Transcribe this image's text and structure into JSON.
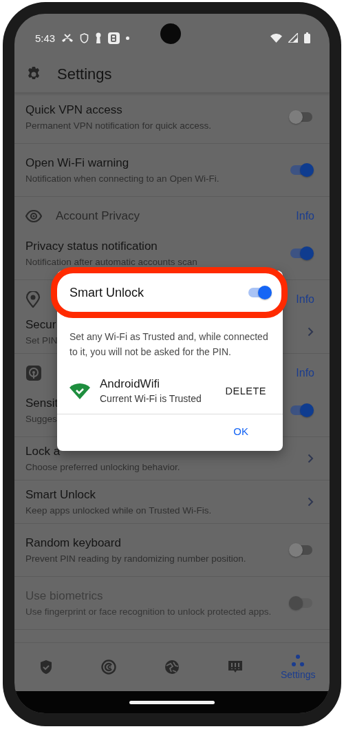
{
  "status_bar": {
    "time": "5:43"
  },
  "app_bar": {
    "title": "Settings"
  },
  "rows": [
    {
      "kind": "toggle",
      "title": "Quick VPN access",
      "subtitle": "Permanent VPN notification for quick access.",
      "on": false,
      "disabled": false
    },
    {
      "kind": "toggle",
      "title": "Open Wi-Fi warning",
      "subtitle": "Notification when connecting to an Open Wi-Fi.",
      "on": true,
      "disabled": false
    },
    {
      "kind": "section",
      "title": "Account Privacy",
      "info": "Info"
    },
    {
      "kind": "toggle",
      "title": "Privacy status notification",
      "subtitle": "Notification after automatic accounts scan",
      "on": true,
      "disabled": false
    },
    {
      "kind": "section",
      "info": "Info"
    },
    {
      "kind": "link",
      "title": "Secur",
      "subtitle": "Set PIN"
    },
    {
      "kind": "section",
      "info": "Info"
    },
    {
      "kind": "toggle",
      "title": "Sensit",
      "subtitle": "Sugges",
      "on": true,
      "disabled": false
    },
    {
      "kind": "link",
      "title": "Lock a",
      "subtitle": "Choose preferred unlocking behavior."
    },
    {
      "kind": "link",
      "title": "Smart Unlock",
      "subtitle": "Keep apps unlocked while on Trusted Wi-Fis."
    },
    {
      "kind": "toggle",
      "title": "Random keyboard",
      "subtitle": "Prevent PIN reading by randomizing number position.",
      "on": false,
      "disabled": false
    },
    {
      "kind": "toggle",
      "title": "Use biometrics",
      "subtitle": "Use fingerprint or face recognition to unlock protected apps.",
      "on": false,
      "disabled": true
    }
  ],
  "dialog": {
    "title": "Smart Unlock",
    "on": true,
    "description": "Set any Wi-Fi as Trusted and, while connected to it, you will not be asked for the PIN.",
    "network": {
      "name": "AndroidWifi",
      "status": "Current Wi-Fi is Trusted",
      "action": "DELETE"
    },
    "button": "OK"
  },
  "nav": [
    {
      "selected": false
    },
    {
      "selected": false
    },
    {
      "selected": false
    },
    {
      "selected": false
    },
    {
      "label": "Settings",
      "selected": true
    }
  ]
}
